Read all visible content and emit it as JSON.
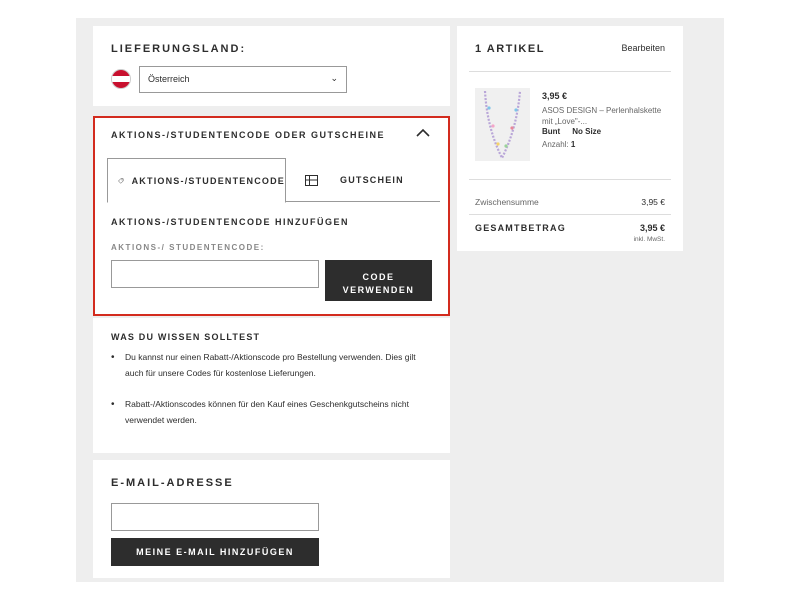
{
  "delivery": {
    "title": "LIEFERUNGSLAND:",
    "country": "Österreich"
  },
  "promo": {
    "header": "AKTIONS-/STUDENTENCODE ODER GUTSCHEINE",
    "tabs": [
      {
        "label": "AKTIONS-/STUDENTENCODE",
        "icon": "tag-icon"
      },
      {
        "label": "GUTSCHEIN",
        "icon": "gift-card-icon"
      }
    ],
    "add_title": "AKTIONS-/STUDENTENCODE HINZUFÜGEN",
    "field_label": "AKTIONS-/ STUDENTENCODE:",
    "field_value": "",
    "apply_line1": "CODE",
    "apply_line2": "VERWENDEN",
    "highlight_color": "#d32b1e"
  },
  "know": {
    "title": "WAS DU WISSEN SOLLTEST",
    "items": [
      "Du kannst nur einen Rabatt-/Aktionscode pro Bestellung verwenden. Dies gilt auch für unsere Codes für kostenlose Lieferungen.",
      "Rabatt-/Aktionscodes können für den Kauf eines Geschenkgutscheins nicht verwendet werden."
    ]
  },
  "email": {
    "title": "E-MAIL-ADRESSE",
    "value": "",
    "button": "MEINE E-MAIL HINZUFÜGEN"
  },
  "cart": {
    "title": "1 ARTIKEL",
    "edit": "Bearbeiten",
    "product": {
      "price": "3,95 €",
      "name": "ASOS DESIGN – Perlenhalskette mit „Love\"-...",
      "color": "Bunt",
      "size": "No Size",
      "qty_label": "Anzahl:",
      "qty": "1"
    },
    "subtotal_label": "Zwischensumme",
    "subtotal": "3,95 €",
    "total_label": "GESAMTBETRAG",
    "total": "3,95 €",
    "vat_note": "inkl. MwSt."
  }
}
